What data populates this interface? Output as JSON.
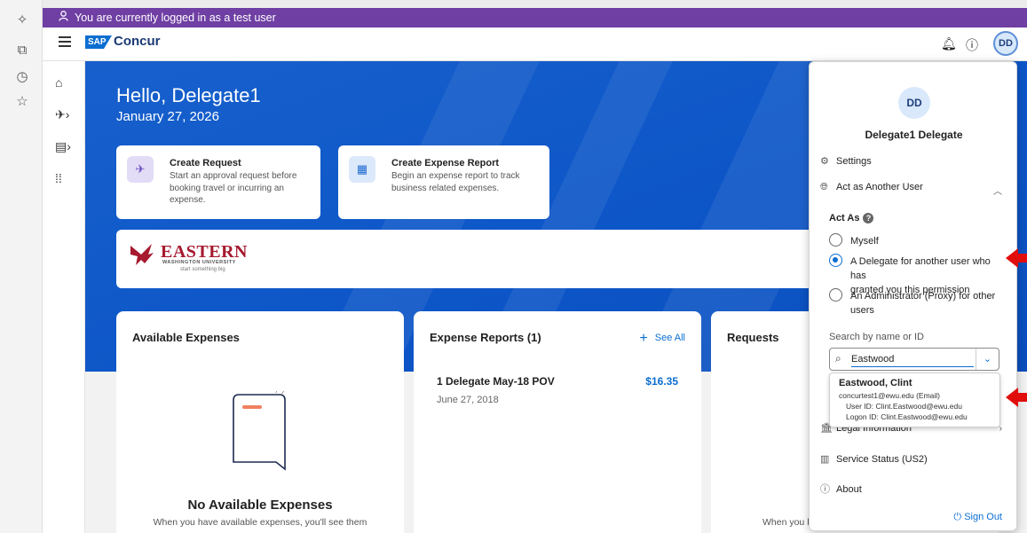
{
  "banner": {
    "text": "You are currently logged in as a test user"
  },
  "header": {
    "brand_sap": "SAP",
    "brand_name": "Concur",
    "avatar_initials": "DD"
  },
  "hero": {
    "greeting": "Hello, Delegate1",
    "date": "January 27, 2026"
  },
  "actions": [
    {
      "title": "Create Request",
      "desc1": "Start an approval request before",
      "desc2": "booking travel or incurring an",
      "desc3": "expense."
    },
    {
      "title": "Create Expense Report",
      "desc1": "Begin an expense report to track",
      "desc2": "business related expenses.",
      "desc3": ""
    }
  ],
  "org_logo": {
    "name": "EASTERN",
    "sub": "WASHINGTON UNIVERSITY",
    "tagline": "start something big"
  },
  "panels": {
    "available": {
      "title": "Available Expenses",
      "empty_title": "No Available Expenses",
      "empty_desc": "When you have available expenses, you'll see them"
    },
    "reports": {
      "title": "Expense Reports (1)",
      "see_all": "See All",
      "item_title": "1 Delegate May-18 POV",
      "item_amount": "$16.35",
      "item_date": "June 27, 2018"
    },
    "requests": {
      "title": "Requests",
      "partial_text": "When you h"
    }
  },
  "user_menu": {
    "initials": "DD",
    "name": "Delegate1 Delegate",
    "settings": "Settings",
    "act_as_user": "Act as Another User",
    "act_as_heading": "Act As",
    "options": [
      {
        "line1": "Myself",
        "line2": "",
        "selected": false
      },
      {
        "line1": "A Delegate for another user who has",
        "line2": "granted you this permission",
        "selected": true
      },
      {
        "line1": "An Administrator (Proxy) for other",
        "line2": "users",
        "selected": false
      }
    ],
    "search_label": "Search by name or ID",
    "search_value": "Eastwood",
    "suggestion": {
      "name": "Eastwood, Clint",
      "email": "concurtest1@ewu.edu (Email)",
      "user_id": "User ID: Clint.Eastwood@ewu.edu",
      "logon_id": "Logon ID: Clint.Eastwood@ewu.edu"
    },
    "legal": "Legal Information",
    "service_status": "Service Status (US2)",
    "about": "About",
    "sign_out": "Sign Out"
  },
  "colors": {
    "banner": "#6f3fa3",
    "brand_blue": "#0a6ed1",
    "hero": "#0d56c8",
    "arrow": "#e10d0d"
  }
}
